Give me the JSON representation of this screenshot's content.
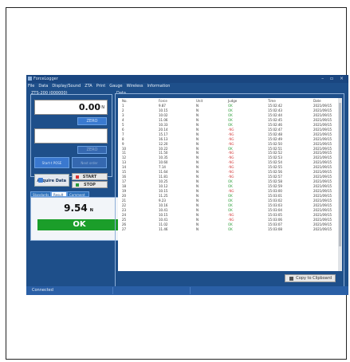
{
  "window": {
    "title": "ForceLogger",
    "controls": "–  ▫  ×"
  },
  "menu": [
    "File",
    "Data",
    "Display/Sound",
    "ZTA",
    "Print",
    "Gauge",
    "Wireless",
    "Information"
  ],
  "left": {
    "group_label": "ZTS-200 (000000)",
    "reading1": {
      "value": "0.00",
      "unit": "N"
    },
    "zero1": "ZERO",
    "zero2": "ZERO",
    "btn_a": "Start-t POSE",
    "btn_b": "Next order",
    "acquire": "Acquire Data",
    "start": "START",
    "stop": "STOP",
    "tabs": [
      "Standards",
      "Result",
      "Comment"
    ],
    "result": {
      "value": "9.54",
      "unit": "N",
      "judge": "OK"
    }
  },
  "data": {
    "group_label": "Data",
    "headers": [
      "No.",
      "Force",
      "Unit",
      "Judge",
      "Time",
      "Date"
    ],
    "rows": [
      [
        "1",
        "9.87",
        "N",
        "OK",
        "15:02:42",
        "2021/09/15"
      ],
      [
        "2",
        "10.15",
        "N",
        "OK",
        "15:02:43",
        "2021/09/15"
      ],
      [
        "3",
        "10.02",
        "N",
        "OK",
        "15:02:44",
        "2021/09/15"
      ],
      [
        "4",
        "11.06",
        "N",
        "OK",
        "15:02:45",
        "2021/09/15"
      ],
      [
        "5",
        "10.33",
        "N",
        "OK",
        "15:02:46",
        "2021/09/15"
      ],
      [
        "6",
        "20.14",
        "N",
        "-NG",
        "15:02:47",
        "2021/09/15"
      ],
      [
        "7",
        "15.17",
        "N",
        "-NG",
        "15:02:48",
        "2021/09/15"
      ],
      [
        "8",
        "16.13",
        "N",
        "-NG",
        "15:02:49",
        "2021/09/15"
      ],
      [
        "9",
        "12.20",
        "N",
        "-NG",
        "15:02:50",
        "2021/09/15"
      ],
      [
        "10",
        "10.22",
        "N",
        "OK",
        "15:02:51",
        "2021/09/15"
      ],
      [
        "11",
        "11.50",
        "N",
        "-NG",
        "15:02:52",
        "2021/09/15"
      ],
      [
        "12",
        "10.35",
        "N",
        "-NG",
        "15:02:53",
        "2021/09/15"
      ],
      [
        "13",
        "10.60",
        "N",
        "-NG",
        "15:02:54",
        "2021/09/15"
      ],
      [
        "14",
        "7.14",
        "N",
        "-NG",
        "15:02:55",
        "2021/09/15"
      ],
      [
        "15",
        "11.64",
        "N",
        "-NG",
        "15:02:56",
        "2021/09/15"
      ],
      [
        "16",
        "11.81",
        "N",
        "-NG",
        "15:02:57",
        "2021/09/15"
      ],
      [
        "17",
        "10.25",
        "N",
        "OK",
        "15:02:58",
        "2021/09/15"
      ],
      [
        "18",
        "10.12",
        "N",
        "OK",
        "15:02:59",
        "2021/09/15"
      ],
      [
        "19",
        "10.15",
        "N",
        "-NG",
        "15:03:00",
        "2021/09/15"
      ],
      [
        "20",
        "11.25",
        "N",
        "OK",
        "15:03:01",
        "2021/09/15"
      ],
      [
        "21",
        "9.23",
        "N",
        "OK",
        "15:03:02",
        "2021/09/15"
      ],
      [
        "22",
        "10.16",
        "N",
        "OK",
        "15:03:03",
        "2021/09/15"
      ],
      [
        "23",
        "10.41",
        "N",
        "OK",
        "15:03:04",
        "2021/09/15"
      ],
      [
        "24",
        "10.15",
        "N",
        "-NG",
        "15:03:05",
        "2021/09/15"
      ],
      [
        "25",
        "10.41",
        "N",
        "-NG",
        "15:03:06",
        "2021/09/15"
      ],
      [
        "26",
        "11.02",
        "N",
        "OK",
        "15:03:07",
        "2021/09/15"
      ],
      [
        "27",
        "11.46",
        "N",
        "OK",
        "15:03:08",
        "2021/09/15"
      ]
    ],
    "copy": "Copy to Clipboard"
  },
  "status": "Connected",
  "colors": {
    "ok": "#2e9e3b",
    "ng": "#d64b4b",
    "judge_bar": "#1b9e2a"
  }
}
